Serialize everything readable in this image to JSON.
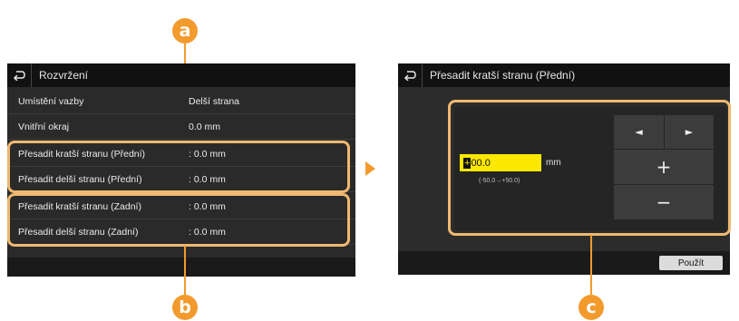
{
  "markers": {
    "a": "a",
    "b": "b",
    "c": "c"
  },
  "left_screen": {
    "title": "Rozvržení",
    "rows": [
      {
        "label": "Umístění vazby",
        "value": "Delší strana"
      },
      {
        "label": "Vnitřní okraj",
        "value": "0.0 mm"
      },
      {
        "label": "Přesadit kratší stranu (Přední)",
        "value": ": 0.0 mm"
      },
      {
        "label": "Přesadit delší stranu (Přední)",
        "value": ": 0.0 mm"
      },
      {
        "label": "Přesadit kratší stranu (Zadní)",
        "value": ": 0.0 mm"
      },
      {
        "label": "Přesadit delší stranu (Zadní)",
        "value": ": 0.0 mm"
      }
    ]
  },
  "right_screen": {
    "title": "Přesadit kratší stranu (Přední)",
    "input_cursor": "+",
    "input_value": "00.0",
    "unit": "mm",
    "range": "(-50.0→+50.0)",
    "left_label": "◄",
    "right_label": "►",
    "plus_label": "+",
    "minus_label": "−",
    "apply_label": "Použít"
  },
  "icons": {
    "back": "back-arrow-icon",
    "next": "next-step-arrow-icon"
  },
  "colors": {
    "accent": "#f39a2d",
    "input": "#fbe700",
    "screen": "#2a2a2a"
  }
}
